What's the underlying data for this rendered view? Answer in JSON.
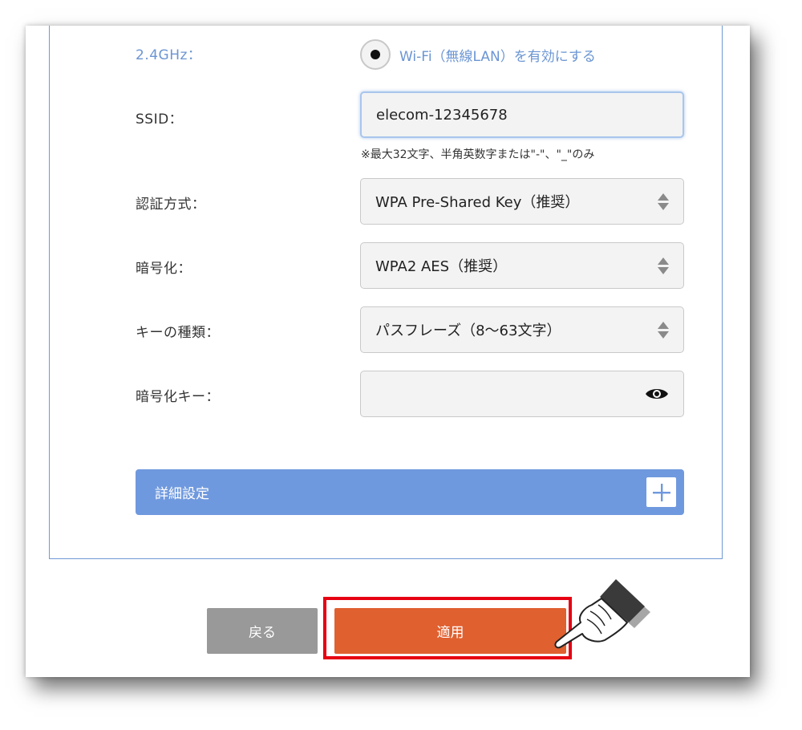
{
  "wifi": {
    "band_label": "2.4GHz：",
    "enable_label": "Wi-Fi（無線LAN）を有効にする",
    "ssid_label": "SSID：",
    "ssid_value": "elecom-12345678",
    "ssid_note": "※最大32文字、半角英数字または\"-\"、\"_\"のみ",
    "auth_label": "認証方式：",
    "auth_value": "WPA Pre-Shared Key（推奨）",
    "enc_label": "暗号化：",
    "enc_value": "WPA2 AES（推奨）",
    "keytype_label": "キーの種類：",
    "keytype_value": "パスフレーズ（8〜63文字）",
    "key_label": "暗号化キー：",
    "key_value": ""
  },
  "advanced": {
    "label": "詳細設定"
  },
  "buttons": {
    "back": "戻る",
    "apply": "適用"
  },
  "colors": {
    "accent_blue": "#6f99de",
    "apply_orange": "#e06030",
    "back_gray": "#999999",
    "highlight_red": "#e60012"
  }
}
